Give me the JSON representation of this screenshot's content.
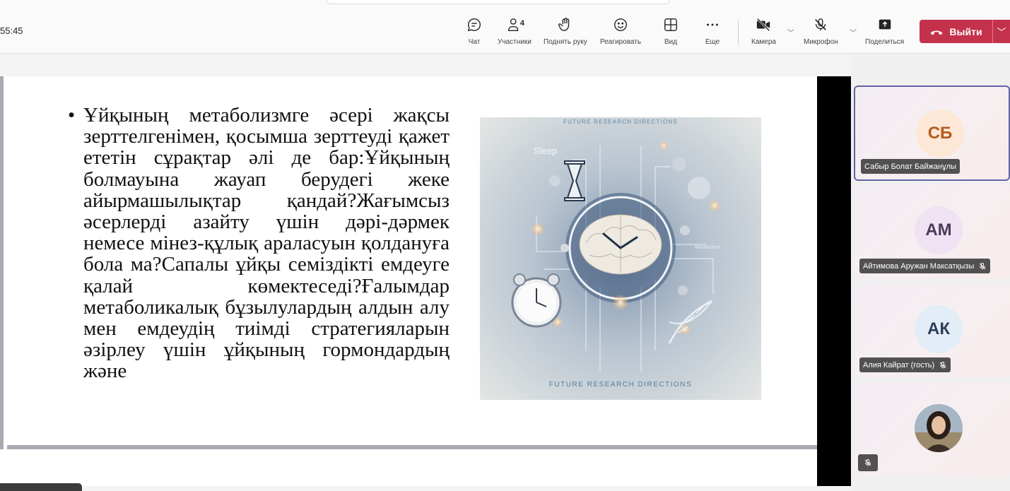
{
  "meeting": {
    "timer": "55:45"
  },
  "toolbar": {
    "chat_label": "Чат",
    "participants_label": "Участники",
    "participants_count": "4",
    "raise_hand_label": "Поднять руку",
    "react_label": "Реагировать",
    "view_label": "Вид",
    "more_label": "Еще",
    "camera_label": "Камера",
    "mic_label": "Микрофон",
    "share_label": "Поделиться",
    "leave_label": "Выйти"
  },
  "slide": {
    "body_text": "Ұйқының метаболизмге әсері жақсы зерттелгенімен, қосымша зерттеуді қажет ететін сұрақтар әлі де бар:Ұйқының болмауына жауап берудегі жеке айырмашылықтар қандай?Жағымсыз әсерлерді азайту үшін дәрі-дәрмек немесе мінез-құлық араласуын қолдануға бола ма?Сапалы ұйқы семіздікті емдеуге қалай көмектеседі?Ғалымдар метаболикалық бұзылулардың алдын алу мен емдеудің тиімді стратегияларын әзірлеу үшін ұйқының гормондардың және",
    "image": {
      "top_caption": "FUTURE RESEARCH DIRECTIONS",
      "bottom_caption": "FUTURE RESEARCH DIRECTIONS",
      "sleep_label": "Sleep",
      "metabolism_label": "Metabolism"
    }
  },
  "participants": [
    {
      "initials": "СБ",
      "name": "Сабыр Болат Байжанұлы",
      "muted": false,
      "avatar_bg": "#fde7d6",
      "avatar_fg": "#b35c1e",
      "active": true
    },
    {
      "initials": "АМ",
      "name": "Айтимова Аружан Максатқызы",
      "muted": true,
      "avatar_bg": "#efe3f3",
      "avatar_fg": "#4b3a5a",
      "active": false
    },
    {
      "initials": "АК",
      "name": "Алия Кайрат (гость)",
      "muted": true,
      "avatar_bg": "#e3edf7",
      "avatar_fg": "#2c3e58",
      "active": false
    },
    {
      "initials": "",
      "name": "",
      "muted": true,
      "photo": true
    }
  ],
  "colors": {
    "leave": "#c4314b",
    "active_border": "#6264a7"
  }
}
